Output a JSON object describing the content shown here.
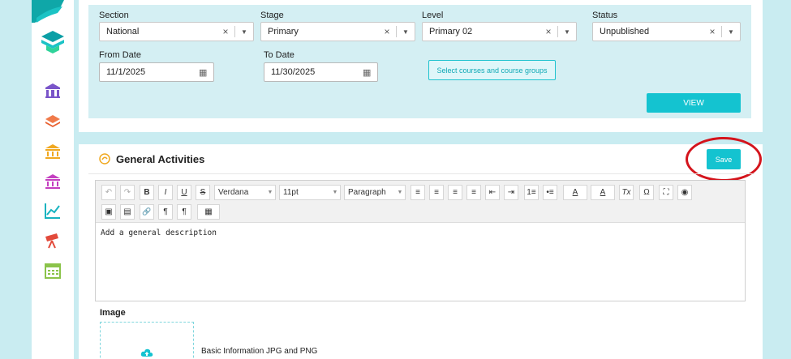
{
  "filters": {
    "section": {
      "label": "Section",
      "value": "National"
    },
    "stage": {
      "label": "Stage",
      "value": "Primary"
    },
    "level": {
      "label": "Level",
      "value": "Primary 02"
    },
    "status": {
      "label": "Status",
      "value": "Unpublished"
    },
    "from_date": {
      "label": "From Date",
      "value": "11/1/2025"
    },
    "to_date": {
      "label": "To Date",
      "value": "11/30/2025"
    },
    "select_courses_label": "Select courses and course groups",
    "view_label": "VIEW",
    "clear_glyph": "×",
    "arrow_glyph": "▼",
    "calendar_glyph": "▦"
  },
  "activities": {
    "title": "General Activities",
    "save_label": "Save",
    "editor": {
      "font_family": "Verdana",
      "font_size": "11pt",
      "block_format": "Paragraph",
      "content": "Add a general description",
      "buttons": {
        "undo": "↶",
        "redo": "↷",
        "bold": "B",
        "italic": "I",
        "underline": "U",
        "strike": "S",
        "align_left": "≡",
        "align_center": "≡",
        "align_right": "≡",
        "justify": "≡",
        "outdent": "⇤",
        "indent": "⇥",
        "ordered_list": "1≡",
        "bullet_list": "•≡",
        "text_color": "A",
        "bg_color": "A",
        "clear_format": "Tx",
        "special_char": "Ω",
        "fullscreen": "⛶",
        "preview": "◉",
        "image": "▣",
        "media": "▤",
        "link": "🔗",
        "ltr": "¶",
        "rtl": "¶",
        "table": "▦"
      }
    },
    "image_label": "Image",
    "image_hint": "Basic Information JPG and PNG"
  },
  "colors": {
    "accent": "#14c3d0",
    "background": "#c9ecf1",
    "filter_panel": "#d4eff3",
    "annotation": "#d4141c"
  },
  "icons": [
    "school-icon",
    "layers-icon",
    "bank-icon",
    "museum-icon",
    "chart-line-icon",
    "telescope-icon",
    "calendar-icon"
  ]
}
